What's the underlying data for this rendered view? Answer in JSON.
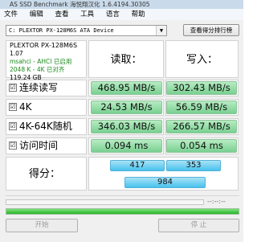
{
  "window": {
    "title": "AS SSD Benchmark 海悦翔汉化 1.6.4194.30305"
  },
  "menu": {
    "items": [
      "文件",
      "编辑",
      "查看",
      "工具",
      "语言",
      "帮助"
    ]
  },
  "drive_select": {
    "value": "C: PLEXTOR PX-128M6S ATA Device"
  },
  "settings_button": {
    "label": "查看得分排行榜"
  },
  "drive_info": {
    "model": "PLEXTOR PX-128M6S",
    "firmware": "1.07",
    "driver": "msahci - AHCI 已启用",
    "alignment": "2048 K - 4K 已对齐",
    "capacity": "119.24 GB"
  },
  "headers": {
    "read": "读取：",
    "write": "写入："
  },
  "rows": [
    {
      "label": "连续读写",
      "read": "468.95 MB/s",
      "write": "302.43 MB/s"
    },
    {
      "label": "4K",
      "read": "24.53 MB/s",
      "write": "56.59 MB/s"
    },
    {
      "label": "4K-64K随机",
      "read": "346.03 MB/s",
      "write": "266.57 MB/s"
    },
    {
      "label": "访问时间",
      "read": "0.094 ms",
      "write": "0.054 ms"
    }
  ],
  "checkbox_mark": "☑",
  "score": {
    "label": "得分：",
    "read": "417",
    "write": "353",
    "total": "984"
  },
  "status": {
    "dashes": "--:--:--"
  },
  "progress": {
    "fraction": 1.0
  },
  "buttons": {
    "start": "开始",
    "stop": "停 止"
  },
  "colors": {
    "result_green": "#79cf91",
    "score_blue": "#48c2ee",
    "progress_green": "#27b427"
  }
}
